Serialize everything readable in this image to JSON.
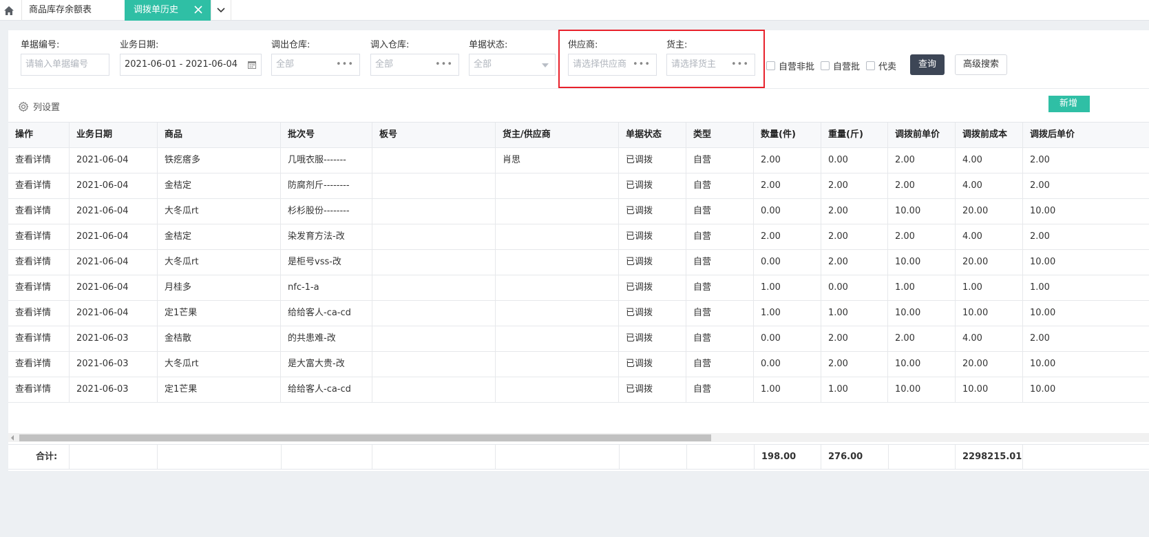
{
  "tabs": {
    "home_icon": "home-icon",
    "items": [
      {
        "label": "商品库存余额表"
      },
      {
        "label": "调拨单历史"
      }
    ]
  },
  "filters": {
    "order_no": {
      "label": "单据编号:",
      "placeholder": "请输入单据编号"
    },
    "biz_date": {
      "label": "业务日期:",
      "value": "2021-06-01 - 2021-06-04"
    },
    "out_wh": {
      "label": "调出仓库:",
      "value": "全部"
    },
    "in_wh": {
      "label": "调入仓库:",
      "value": "全部"
    },
    "status": {
      "label": "单据状态:",
      "value": "全部"
    },
    "supplier": {
      "label": "供应商:",
      "placeholder": "请选择供应商"
    },
    "owner": {
      "label": "货主:",
      "placeholder": "请选择货主"
    },
    "checkboxes": [
      {
        "label": "自营非批",
        "checked": false
      },
      {
        "label": "自营批",
        "checked": false
      },
      {
        "label": "代卖",
        "checked": false
      }
    ],
    "query_button": "查询",
    "advanced_button": "高级搜索"
  },
  "toolbar": {
    "column_settings": "列设置",
    "new_button": "新增"
  },
  "table": {
    "columns": [
      "操作",
      "业务日期",
      "商品",
      "批次号",
      "板号",
      "货主/供应商",
      "单据状态",
      "类型",
      "数量(件)",
      "重量(斤)",
      "调拨前单价",
      "调拨前成本",
      "调拨后单价"
    ],
    "rows": [
      [
        "查看详情",
        "2021-06-04",
        "铁疙瘩多",
        "几哦衣服-------",
        "",
        "肖思",
        "已调拨",
        "自营",
        "2.00",
        "0.00",
        "2.00",
        "4.00",
        "2.00"
      ],
      [
        "查看详情",
        "2021-06-04",
        "金桔定",
        "防腐剂斤--------",
        "",
        "",
        "已调拨",
        "自营",
        "2.00",
        "2.00",
        "2.00",
        "4.00",
        "2.00"
      ],
      [
        "查看详情",
        "2021-06-04",
        "大冬瓜rt",
        "杉杉股份--------",
        "",
        "",
        "已调拨",
        "自营",
        "0.00",
        "2.00",
        "10.00",
        "20.00",
        "10.00"
      ],
      [
        "查看详情",
        "2021-06-04",
        "金桔定",
        "染发育方法-改",
        "",
        "",
        "已调拨",
        "自营",
        "2.00",
        "2.00",
        "2.00",
        "4.00",
        "2.00"
      ],
      [
        "查看详情",
        "2021-06-04",
        "大冬瓜rt",
        "是柜号vss-改",
        "",
        "",
        "已调拨",
        "自营",
        "0.00",
        "2.00",
        "10.00",
        "20.00",
        "10.00"
      ],
      [
        "查看详情",
        "2021-06-04",
        "月桂多",
        "nfc-1-a",
        "",
        "",
        "已调拨",
        "自营",
        "1.00",
        "0.00",
        "1.00",
        "1.00",
        "1.00"
      ],
      [
        "查看详情",
        "2021-06-04",
        "定1芒果",
        "给给客人-ca-cd",
        "",
        "",
        "已调拨",
        "自营",
        "1.00",
        "1.00",
        "10.00",
        "10.00",
        "10.00"
      ],
      [
        "查看详情",
        "2021-06-03",
        "金桔散",
        "的共患难-改",
        "",
        "",
        "已调拨",
        "自营",
        "0.00",
        "2.00",
        "2.00",
        "4.00",
        "2.00"
      ],
      [
        "查看详情",
        "2021-06-03",
        "大冬瓜rt",
        "是大富大贵-改",
        "",
        "",
        "已调拨",
        "自营",
        "0.00",
        "2.00",
        "10.00",
        "20.00",
        "10.00"
      ],
      [
        "查看详情",
        "2021-06-03",
        "定1芒果",
        "给给客人-ca-cd",
        "",
        "",
        "已调拨",
        "自营",
        "1.00",
        "1.00",
        "10.00",
        "10.00",
        "10.00"
      ]
    ],
    "footer": [
      "合计:",
      "",
      "",
      "",
      "",
      "",
      "",
      "",
      "198.00",
      "276.00",
      "",
      "2298215.01",
      ""
    ]
  },
  "colors": {
    "accent": "#2fbfa5",
    "dark_button": "#3d4656",
    "highlight_border": "#e8202a"
  }
}
